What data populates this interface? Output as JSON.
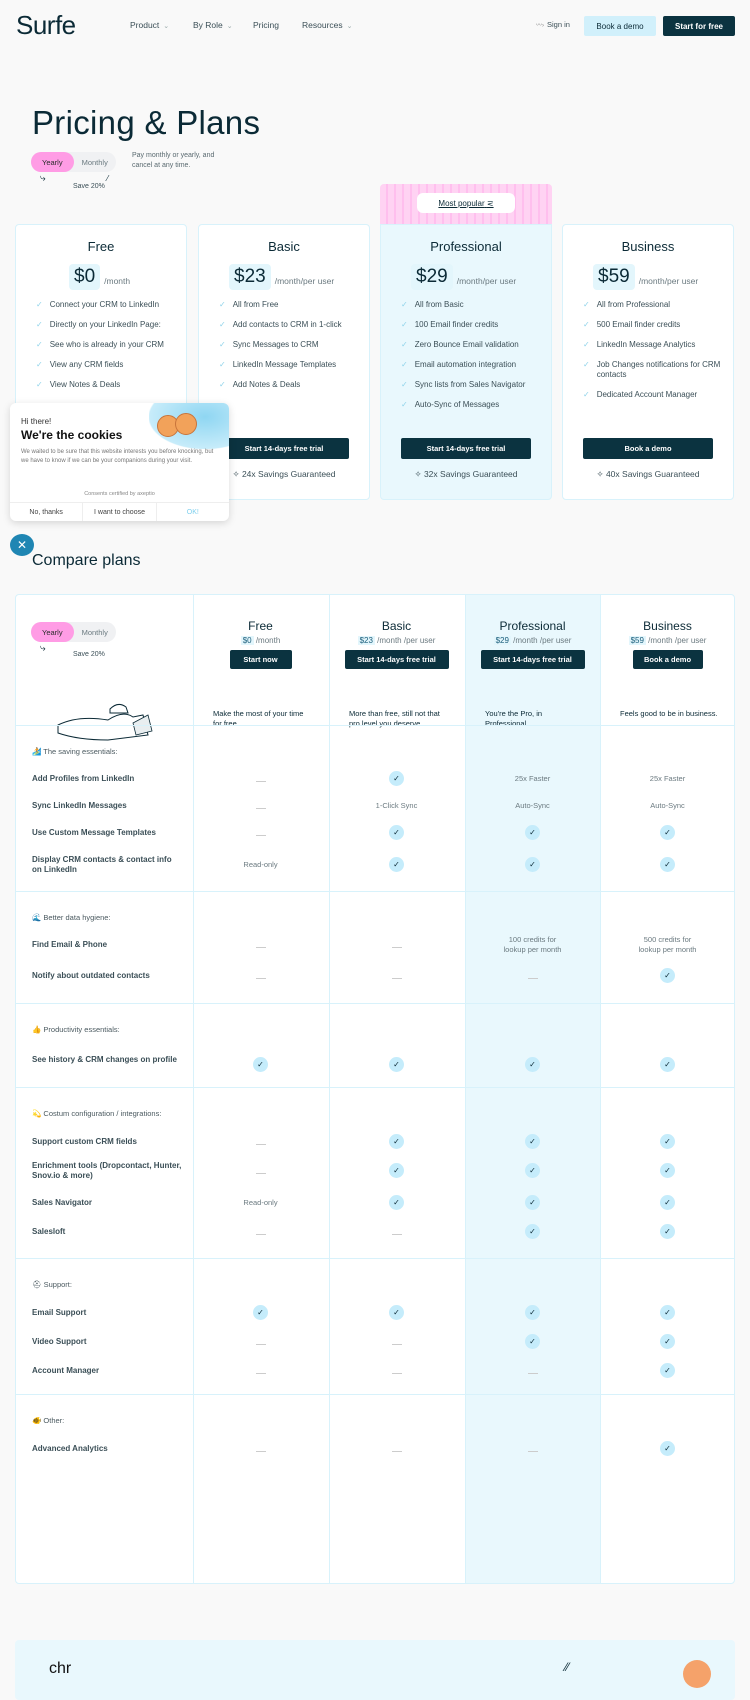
{
  "nav": {
    "logo": "Surfe",
    "links": [
      {
        "label": "Product",
        "dropdown": true
      },
      {
        "label": "By Role",
        "dropdown": true
      },
      {
        "label": "Pricing",
        "dropdown": false
      },
      {
        "label": "Resources",
        "dropdown": true
      }
    ],
    "sign_in": "Sign in",
    "book_demo": "Book a demo",
    "start_free": "Start for free"
  },
  "hero": {
    "title": "Pricing & Plans",
    "toggle": {
      "yearly": "Yearly",
      "monthly": "Monthly",
      "selected": "Yearly"
    },
    "save": "Save 20%",
    "pay_text": "Pay monthly or yearly, and cancel at any time.",
    "most_popular": "Most popular"
  },
  "plans": [
    {
      "name": "Free",
      "price": "$0",
      "period": "/month",
      "features": [
        "Connect your CRM to LinkedIn",
        "Directly on your LinkedIn Page:",
        "See who is already in your CRM",
        "View any CRM fields",
        "View Notes & Deals"
      ],
      "cta": "",
      "savings": ""
    },
    {
      "name": "Basic",
      "price": "$23",
      "period": "/month/per user",
      "features": [
        "All from Free",
        "Add contacts to CRM in 1-click",
        "Sync Messages to CRM",
        "LinkedIn Message Templates",
        "Add Notes & Deals"
      ],
      "cta": "Start 14-days free trial",
      "savings": "24x Savings Guaranteed"
    },
    {
      "name": "Professional",
      "price": "$29",
      "period": "/month/per user",
      "features": [
        "All from Basic",
        "100 Email finder credits",
        "Zero Bounce Email validation",
        "Email automation integration",
        "Sync lists from Sales Navigator",
        "Auto-Sync of Messages"
      ],
      "cta": "Start 14-days free trial",
      "savings": "32x Savings Guaranteed"
    },
    {
      "name": "Business",
      "price": "$59",
      "period": "/month/per user",
      "features": [
        "All from Professional",
        "500 Email finder credits",
        "LinkedIn Message Analytics",
        "Job Changes notifications for CRM contacts",
        "Dedicated Account Manager"
      ],
      "cta": "Book a demo",
      "savings": "40x Savings Guaranteed"
    }
  ],
  "cookie": {
    "hi": "Hi there!",
    "title": "We're the cookies",
    "body": "We waited to be sure that this website interests you before knocking, but we have to know if we can be your companions during your visit.",
    "certified": "Consents certified by axeptio",
    "no": "No, thanks",
    "choose": "I want to choose",
    "ok": "OK!"
  },
  "compare": {
    "title": "Compare plans",
    "toggle": {
      "yearly": "Yearly",
      "monthly": "Monthly"
    },
    "save": "Save 20%",
    "columns": [
      {
        "name": "Free",
        "price": "$0",
        "period": "/month",
        "cta": "Start now",
        "desc": "Make the most of your time for free."
      },
      {
        "name": "Basic",
        "price": "$23",
        "period": "/month /per user",
        "cta": "Start 14-days free trial",
        "desc": "More than free, still not that pro level you deserve."
      },
      {
        "name": "Professional",
        "price": "$29",
        "period": "/month /per user",
        "cta": "Start 14-days free trial",
        "desc": "You're the Pro, in Professional"
      },
      {
        "name": "Business",
        "price": "$59",
        "period": "/month /per user",
        "cta": "Book a demo",
        "desc": "Feels good to be in business."
      }
    ],
    "sections": [
      {
        "title": "🏄 The saving essentials:",
        "rows": [
          {
            "feature": "Add Profiles from LinkedIn",
            "values": [
              "-",
              "check",
              "25x Faster",
              "25x Faster"
            ]
          },
          {
            "feature": "Sync LinkedIn Messages",
            "values": [
              "-",
              "1-Click Sync",
              "Auto-Sync",
              "Auto-Sync"
            ]
          },
          {
            "feature": "Use Custom Message Templates",
            "values": [
              "-",
              "check",
              "check",
              "check"
            ]
          },
          {
            "feature": "Display CRM contacts & contact info on LinkedIn",
            "values": [
              "Read-only",
              "check",
              "check",
              "check"
            ]
          }
        ]
      },
      {
        "title": "🌊 Better data hygiene:",
        "rows": [
          {
            "feature": "Find Email & Phone",
            "values": [
              "-",
              "-",
              "100 credits for lookup per month",
              "500 credits for lookup per month"
            ]
          },
          {
            "feature": "Notify about outdated contacts",
            "values": [
              "-",
              "-",
              "-",
              "check"
            ]
          }
        ]
      },
      {
        "title": "👍 Productivity essentials:",
        "rows": [
          {
            "feature": "See history & CRM changes on profile",
            "values": [
              "check",
              "check",
              "check",
              "check"
            ]
          }
        ]
      },
      {
        "title": "💫 Costum configuration / integrations:",
        "rows": [
          {
            "feature": "Support custom CRM fields",
            "values": [
              "-",
              "check",
              "check",
              "check"
            ]
          },
          {
            "feature": "Enrichment tools (Dropcontact, Hunter, Snov.io & more)",
            "values": [
              "-",
              "check",
              "check",
              "check"
            ]
          },
          {
            "feature": "Sales Navigator",
            "values": [
              "Read-only",
              "check",
              "check",
              "check"
            ]
          },
          {
            "feature": "Salesloft",
            "values": [
              "-",
              "-",
              "check",
              "check"
            ]
          }
        ]
      },
      {
        "title": "⛑ Support:",
        "rows": [
          {
            "feature": "Email Support",
            "values": [
              "check",
              "check",
              "check",
              "check"
            ]
          },
          {
            "feature": "Video Support",
            "values": [
              "-",
              "-",
              "check",
              "check"
            ]
          },
          {
            "feature": "Account Manager",
            "values": [
              "-",
              "-",
              "-",
              "check"
            ]
          }
        ]
      },
      {
        "title": "🐠 Other:",
        "rows": [
          {
            "feature": "Advanced Analytics",
            "values": [
              "-",
              "-",
              "-",
              "check"
            ]
          }
        ]
      }
    ]
  },
  "footer_teaser": {
    "logo": "chr"
  },
  "colors": {
    "accent_dark": "#0b3340",
    "accent_light": "#d1f0fb",
    "toggle_pink": "#ff9ce5",
    "highlight_col": "#e9f8fd"
  }
}
